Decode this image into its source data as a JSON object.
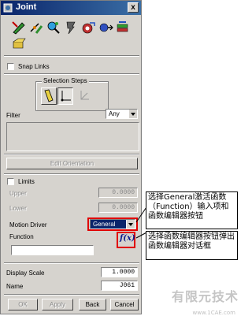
{
  "window": {
    "title": "Joint",
    "close_label": "x"
  },
  "toolbar": {
    "icons": [
      "select-link-icon",
      "joint-origin-icon",
      "inspect-icon",
      "marker-icon",
      "vector-icon",
      "driver-icon",
      "stack-icon"
    ]
  },
  "snap_links": {
    "label": "Snap Links",
    "checked": false
  },
  "selection_steps": {
    "label": "Selection Steps"
  },
  "filter": {
    "label": "Filter",
    "value": "Any"
  },
  "edit_orientation": {
    "label": "Edit Orientation"
  },
  "limits": {
    "label": "Limits",
    "checked": false
  },
  "upper": {
    "label": "Upper",
    "value": "0.0000"
  },
  "lower": {
    "label": "Lower",
    "value": "0.0000"
  },
  "motion_driver": {
    "label": "Motion Driver",
    "value": "General"
  },
  "function": {
    "label": "Function",
    "value": "",
    "fx_label": "f(x)"
  },
  "display_scale": {
    "label": "Display Scale",
    "value": "1.0000"
  },
  "name": {
    "label": "Name",
    "value": "J061"
  },
  "buttons": {
    "ok": "OK",
    "apply": "Apply",
    "back": "Back",
    "cancel": "Cancel"
  },
  "annotations": {
    "motion_driver_note": "选择General激活函数（Function）输入项和函数编辑器按钮",
    "fx_note": "选择函数编辑器按钮弹出函数编辑器对话框"
  },
  "watermark": {
    "text": "有限元技术",
    "url": "www.1CAE.com"
  },
  "colors": {
    "title_bar": "#0a246a",
    "highlight": "#e00000",
    "dialog_bg": "#d6d3ce"
  }
}
